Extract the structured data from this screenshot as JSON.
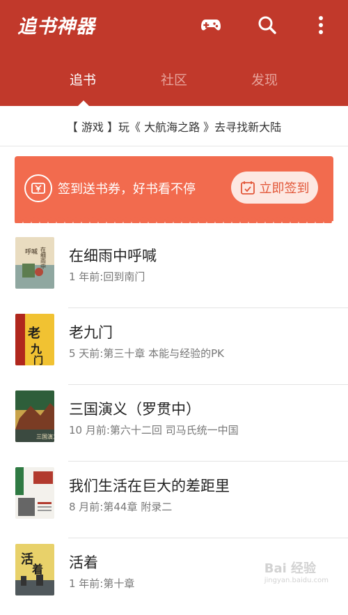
{
  "header": {
    "title": "追书神器",
    "tabs": [
      {
        "label": "追书",
        "active": true
      },
      {
        "label": "社区",
        "active": false
      },
      {
        "label": "发现",
        "active": false
      }
    ],
    "icons": [
      "gamepad-icon",
      "search-icon",
      "more-vertical-icon"
    ],
    "bar_color": "#c1392b"
  },
  "notice": {
    "text": "【 游戏 】玩《 大航海之路 》去寻找新大陆"
  },
  "banner": {
    "text": "签到送书券，好书看不停",
    "button_label": "立即签到",
    "color": "#f26b4e"
  },
  "books": [
    {
      "title": "在细雨中呼喊",
      "subtitle": "1 年前:回到南门"
    },
    {
      "title": "老九门",
      "subtitle": "5 天前:第三十章 本能与经验的PK"
    },
    {
      "title": "三国演义（罗贯中）",
      "subtitle": "10 月前:第六十二回 司马氏统一中国"
    },
    {
      "title": "我们生活在巨大的差距里",
      "subtitle": "8 月前:第44章 附录二"
    },
    {
      "title": "活着",
      "subtitle": "1 年前:第十章"
    }
  ],
  "watermark": {
    "text": "Bai 经验",
    "sub": "jingyan.baidu.com"
  }
}
